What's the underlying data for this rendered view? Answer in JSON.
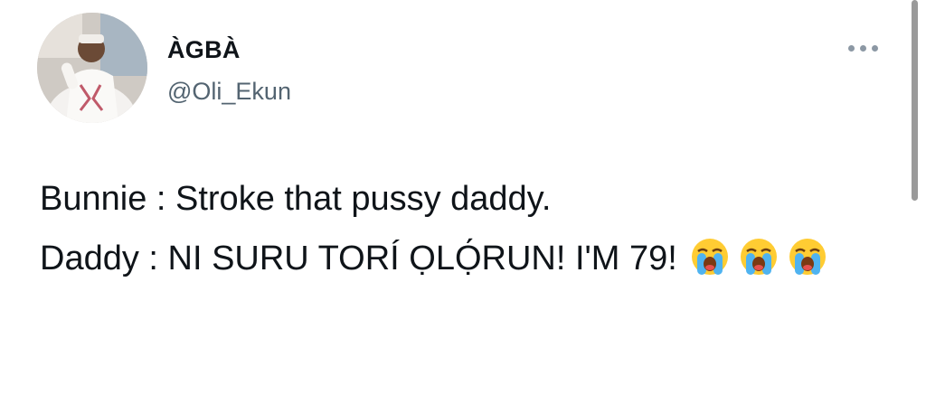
{
  "author": {
    "display_name": "ÀGBÀ",
    "handle": "@Oli_Ekun",
    "avatar_icon": "profile-photo"
  },
  "menu": {
    "more_icon": "ellipsis-icon"
  },
  "tweet": {
    "line1": "Bunnie : Stroke that pussy daddy.",
    "line2": "Daddy : NI SURU TORÍ ỌLỌ́RUN! I'M 79!",
    "emojis": [
      "loudly-crying-face",
      "loudly-crying-face",
      "loudly-crying-face"
    ]
  },
  "colors": {
    "text": "#0f1419",
    "secondary": "#536471",
    "emoji_face": "#ffcc33",
    "emoji_tears": "#4fb3f0"
  }
}
